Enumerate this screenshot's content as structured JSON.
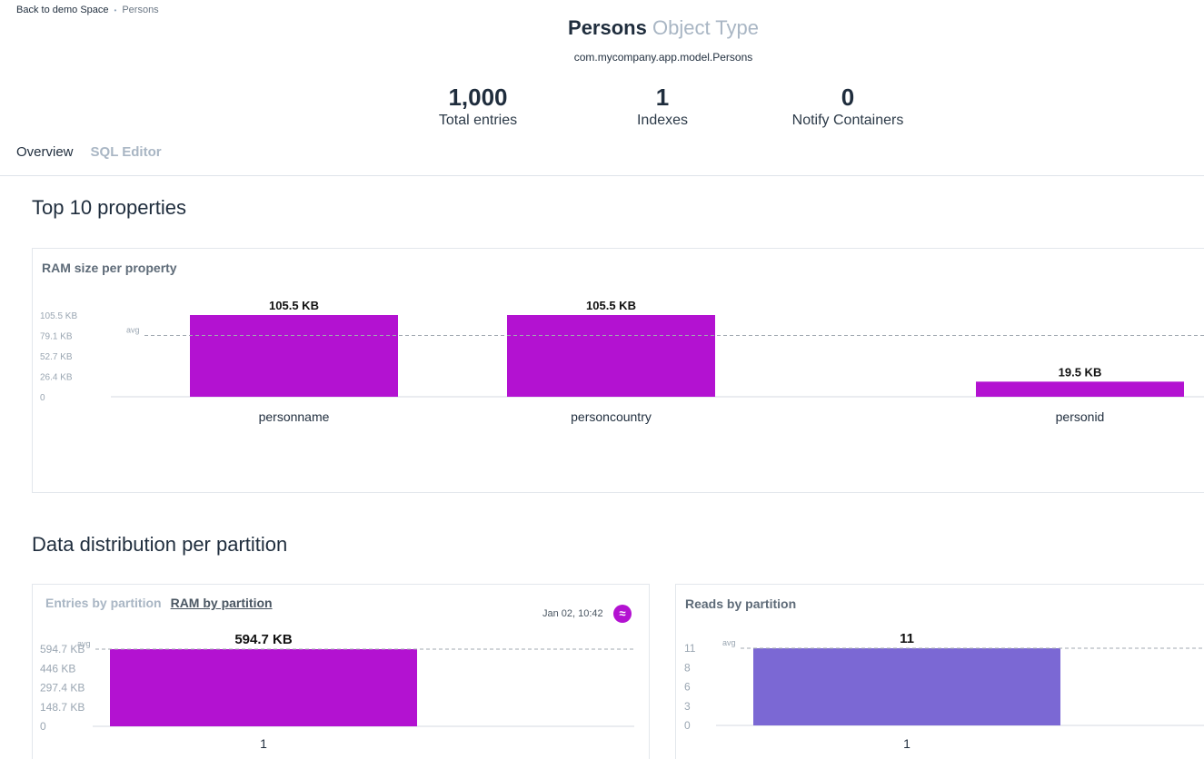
{
  "breadcrumb": {
    "back_label": "Back to demo Space",
    "current": "Persons"
  },
  "header": {
    "name": "Persons",
    "type_label": "Object Type",
    "class_name": "com.mycompany.app.model.Persons"
  },
  "stats": [
    {
      "value": "1,000",
      "label": "Total entries"
    },
    {
      "value": "1",
      "label": "Indexes"
    },
    {
      "value": "0",
      "label": "Notify Containers"
    }
  ],
  "tabs": [
    {
      "label": "Overview"
    },
    {
      "label": "SQL Editor"
    }
  ],
  "sections": {
    "top_properties": "Top 10 properties",
    "distribution": "Data distribution per partition"
  },
  "colors": {
    "bar_magenta": "#b312d1",
    "bar_purple": "#7b68d4",
    "grid": "#c8ced6"
  },
  "ram_card": {
    "title": "RAM size per property"
  },
  "partition_card": {
    "tab_entries": "Entries by partition",
    "tab_ram": "RAM by partition",
    "timestamp": "Jan 02, 10:42",
    "live_icon": "approx-icon"
  },
  "reads_card": {
    "title": "Reads by partition"
  },
  "chart_data": [
    {
      "type": "bar",
      "title": "RAM size per property",
      "categories": [
        "personname",
        "personcountry",
        "personid"
      ],
      "values": [
        105.5,
        105.5,
        19.5
      ],
      "value_labels": [
        "105.5 KB",
        "105.5 KB",
        "19.5 KB"
      ],
      "yticks": [
        "0",
        "26.4 KB",
        "52.7 KB",
        "79.1 KB",
        "105.5 KB"
      ],
      "avg_label": "avg",
      "avg": 79.1,
      "ylim": [
        0,
        105.5
      ],
      "unit": "KB"
    },
    {
      "type": "bar",
      "title": "RAM by partition",
      "categories": [
        "1"
      ],
      "values": [
        594.7
      ],
      "value_labels": [
        "594.7 KB"
      ],
      "yticks": [
        "0",
        "148.7 KB",
        "297.4 KB",
        "446 KB",
        "594.7 KB"
      ],
      "avg_label": "avg",
      "avg": 594.7,
      "ylim": [
        0,
        594.7
      ],
      "unit": "KB"
    },
    {
      "type": "bar",
      "title": "Reads by partition",
      "categories": [
        "1"
      ],
      "values": [
        11
      ],
      "value_labels": [
        "11"
      ],
      "yticks": [
        "0",
        "3",
        "6",
        "8",
        "11"
      ],
      "avg_label": "avg",
      "avg": 11,
      "ylim": [
        0,
        11
      ]
    }
  ]
}
